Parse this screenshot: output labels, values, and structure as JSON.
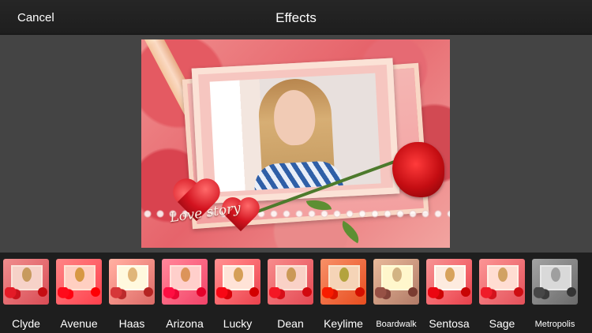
{
  "header": {
    "cancel_label": "Cancel",
    "title": "Effects"
  },
  "photo": {
    "overlay_text": "Love story"
  },
  "filters": [
    {
      "label": "Clyde"
    },
    {
      "label": "Avenue"
    },
    {
      "label": "Haas"
    },
    {
      "label": "Arizona"
    },
    {
      "label": "Lucky"
    },
    {
      "label": "Dean"
    },
    {
      "label": "Keylime"
    },
    {
      "label": "Boardwalk"
    },
    {
      "label": "Sentosa"
    },
    {
      "label": "Sage"
    },
    {
      "label": "Metropolis"
    }
  ],
  "colors": {
    "toolbar_bg": "#1e1e1e",
    "stage_bg": "#444444",
    "text": "#ffffff"
  }
}
